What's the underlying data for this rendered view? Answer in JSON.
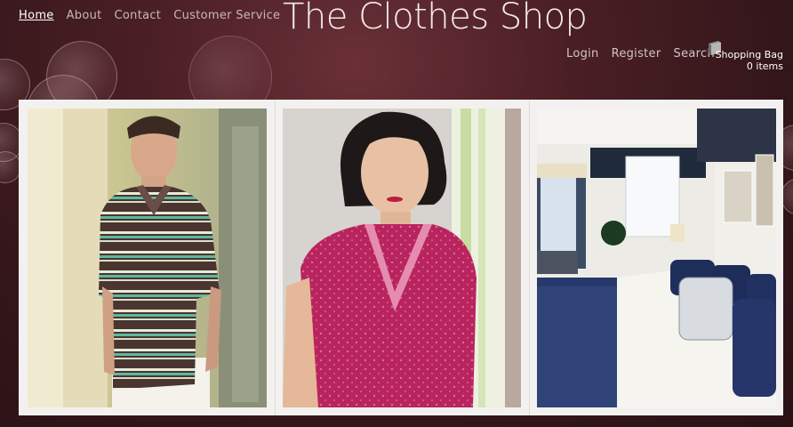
{
  "nav": {
    "items": [
      {
        "label": "Home",
        "active": true
      },
      {
        "label": "About",
        "active": false
      },
      {
        "label": "Contact",
        "active": false
      },
      {
        "label": "Customer Service",
        "active": false
      }
    ]
  },
  "logo": {
    "text": "The Clothes Shop"
  },
  "account": {
    "login": "Login",
    "register": "Register",
    "search": "Search"
  },
  "bag": {
    "label": "Shopping Bag",
    "count": "0 items",
    "icon": "shopping-bag-icon"
  },
  "gallery": {
    "images": [
      {
        "name": "man-striped-polo",
        "alt": "Man in striped polo shirt"
      },
      {
        "name": "woman-pink-top",
        "alt": "Woman in pink floral top"
      },
      {
        "name": "bedroom-interior",
        "alt": "Bedroom with patterned pillows"
      }
    ]
  },
  "colors": {
    "background": "#3a1a1e",
    "frame": "#f3f1ef",
    "nav_text": "#c9b8b8"
  }
}
